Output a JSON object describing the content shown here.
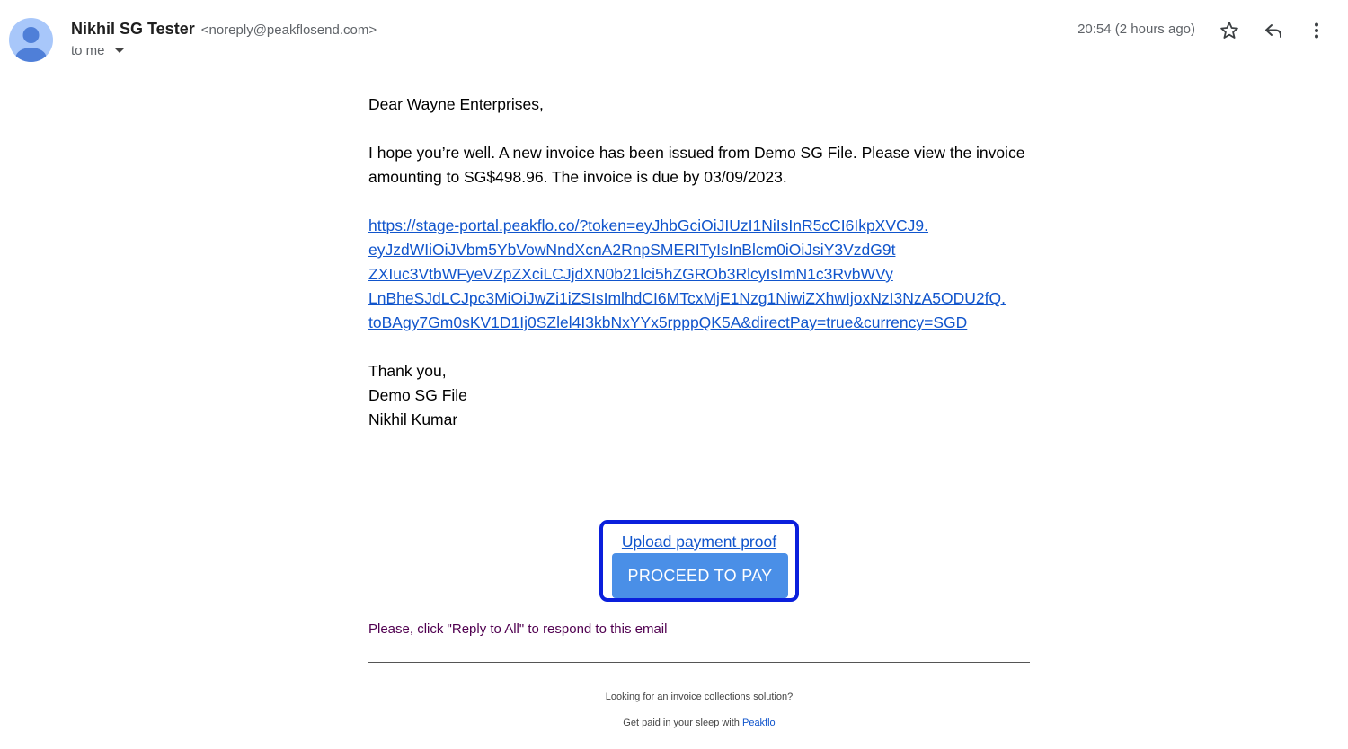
{
  "header": {
    "sender_name": "Nikhil SG Tester",
    "sender_email": "<noreply@peakflosend.com>",
    "recipient": "to me",
    "timestamp": "20:54 (2 hours ago)",
    "icons": [
      "star-icon",
      "reply-icon",
      "more-vert-icon",
      "chevron-down-icon",
      "avatar"
    ]
  },
  "email": {
    "greeting": "Dear Wayne Enterprises,",
    "paragraph_line1": "I hope you’re well. A new invoice has been issued from Demo SG File. Please view the invoice",
    "paragraph_line2": "amounting to SG$498.96. The invoice is due by 03/09/2023.",
    "link_lines": [
      "https://stage-portal.peakflo.co/?token=eyJhbGciOiJIUzI1NiIsInR5cCI6IkpXVCJ9.",
      "eyJzdWIiOiJVbm5YbVowNndXcnA2RnpSMERITyIsInBlcm0iOiJsiY3VzdG9t",
      "ZXIuc3VtbWFyeVZpZXciLCJjdXN0b21lci5hZGROb3RlcyIsImN1c3RvbWVy",
      "LnBheSJdLCJpc3MiOiJwZi1iZSIsImlhdCI6MTcxMjE1Nzg1NiwiZXhwIjoxNzI3NzA5ODU2fQ.",
      "toBAgy7Gm0sKV1D1Ij0SZlel4I3kbNxYYx5rpppQK5A&directPay=true&currency=SGD"
    ],
    "signoff": [
      "Thank you,",
      "Demo SG File",
      "Nikhil Kumar"
    ]
  },
  "cta": {
    "upload_label": "Upload payment proof",
    "pay_label": "PROCEED TO PAY"
  },
  "reply_note": "Please, click \"Reply to All\" to respond to this email",
  "footer": {
    "line1": "Looking for an invoice collections solution?",
    "line2_prefix": "Get paid in your sleep with ",
    "line2_link": "Peakflo"
  },
  "colors": {
    "link": "#1155cc",
    "button": "#4a8fe7",
    "highlight_border": "#0a1fdc",
    "signoff_text": "#500050"
  }
}
